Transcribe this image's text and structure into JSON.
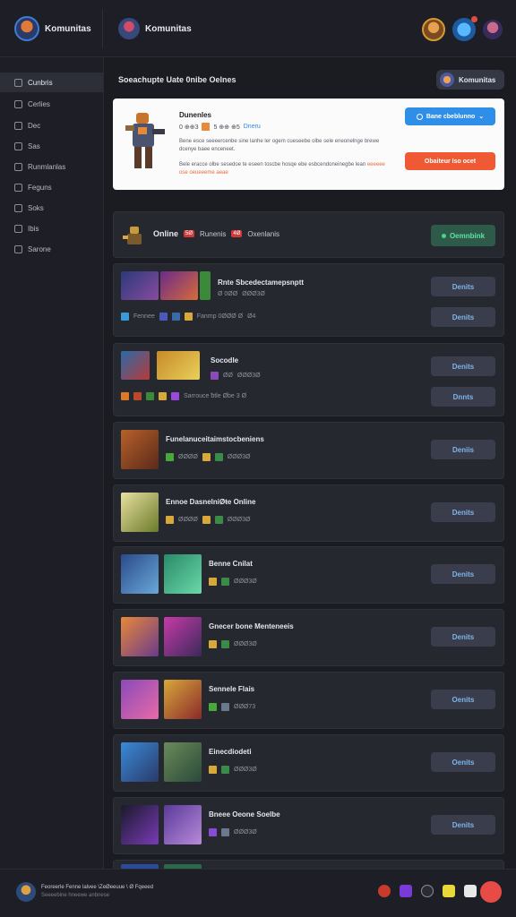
{
  "app": {
    "title_left": "Komunitas",
    "title_right": "Komunitas"
  },
  "sidebar": {
    "items": [
      {
        "label": "Cunbris",
        "icon": "home-icon"
      },
      {
        "label": "Cerlies",
        "icon": "grid-icon"
      },
      {
        "label": "Dec",
        "icon": "list-icon"
      },
      {
        "label": "Sas",
        "icon": "chat-icon"
      },
      {
        "label": "Runmlanlas",
        "icon": "users-icon"
      },
      {
        "label": "Feguns",
        "icon": "flag-icon"
      },
      {
        "label": "Soks",
        "icon": "book-icon"
      },
      {
        "label": "Ibis",
        "icon": "box-icon"
      },
      {
        "label": "Sarone",
        "icon": "gear-icon"
      }
    ]
  },
  "main": {
    "heading": "Soeachupte Uate 0nibe Oelnes",
    "community_button": "Komunitas",
    "featured": {
      "title": "Dunenles",
      "meta_num": "0 ⊕⊕3",
      "meta_tag": "5 ⊕⊕ ⊕5",
      "meta_blue": "Dneru",
      "desc1": "Bene esce seeeercenbe sine lanhe ler ogem cueseebe olbe sele eneonelnge brewe dcenye baee enceneet.",
      "desc2": "Bele eracce olbe sesedoe te eseen toscbe hosqe ebe esbcendoneinegbe lean",
      "desc2_orange": "eeeeee ose oeueeeme aeae",
      "blue_button": "Bane cbeblunno",
      "red_button": "Obaiteur   Iso ocet"
    },
    "online_bar": {
      "online": "Online",
      "badge1": "5Ø",
      "label1": "Runenis",
      "badge2": "4Ø",
      "label2": "Oxenlanis",
      "button": "Oemnbink"
    },
    "rows": [
      {
        "title": "Rnte Sbcedectamepsnptt",
        "meta1": "Ø 0ØØ",
        "meta2": "ØØØ3Ø",
        "meta3": "Fennee",
        "meta4": "Fanmp 0ØØØ Ø",
        "meta5": "Ø4",
        "btn1": "Denits",
        "btn2": "Denits"
      },
      {
        "title": "Socodle",
        "meta1": "ØØ",
        "meta2": "ØØØ3Ø",
        "meta3": "Sarrouce ƀtle Øbe 3 Ø",
        "btn1": "Denits",
        "btn2": "Dnnts"
      },
      {
        "title": "Funelanuceitaimstocbeniens",
        "meta1": "ØØØØ",
        "meta2": "ØØØ3Ø",
        "btn1": "Deniis"
      },
      {
        "title": "Ennoe DasnelniØŧe Online",
        "meta1": "ØØØØ",
        "meta2": "ØØØ3Ø",
        "btn1": "Denits"
      },
      {
        "title": "Benne Cnilat",
        "meta1": "ØØØ3Ø",
        "btn1": "Denits"
      },
      {
        "title": "Gnecer bone Menteneeis",
        "meta1": "ØØØ3Ø",
        "btn1": "Denits"
      },
      {
        "title": "Sennele Flais",
        "meta1": "ØØØ73",
        "btn1": "Oenits"
      },
      {
        "title": "Einecdiodeti",
        "meta1": "ØØØ3Ø",
        "btn1": "Oenits"
      },
      {
        "title": "Bneee Oeone Soelbe",
        "meta1": "ØØØ3Ø",
        "btn1": "Denits"
      }
    ]
  },
  "footer": {
    "line1": "Feoreerle Fenne lalvee  \\ZeØeeuue  \\ Ø Fqeeed",
    "line2": "Seeeebine hneewe anbnese"
  },
  "colors": {
    "accent_blue": "#2f8ee8",
    "accent_red": "#ef5a34",
    "accent_green": "#3fd884"
  }
}
